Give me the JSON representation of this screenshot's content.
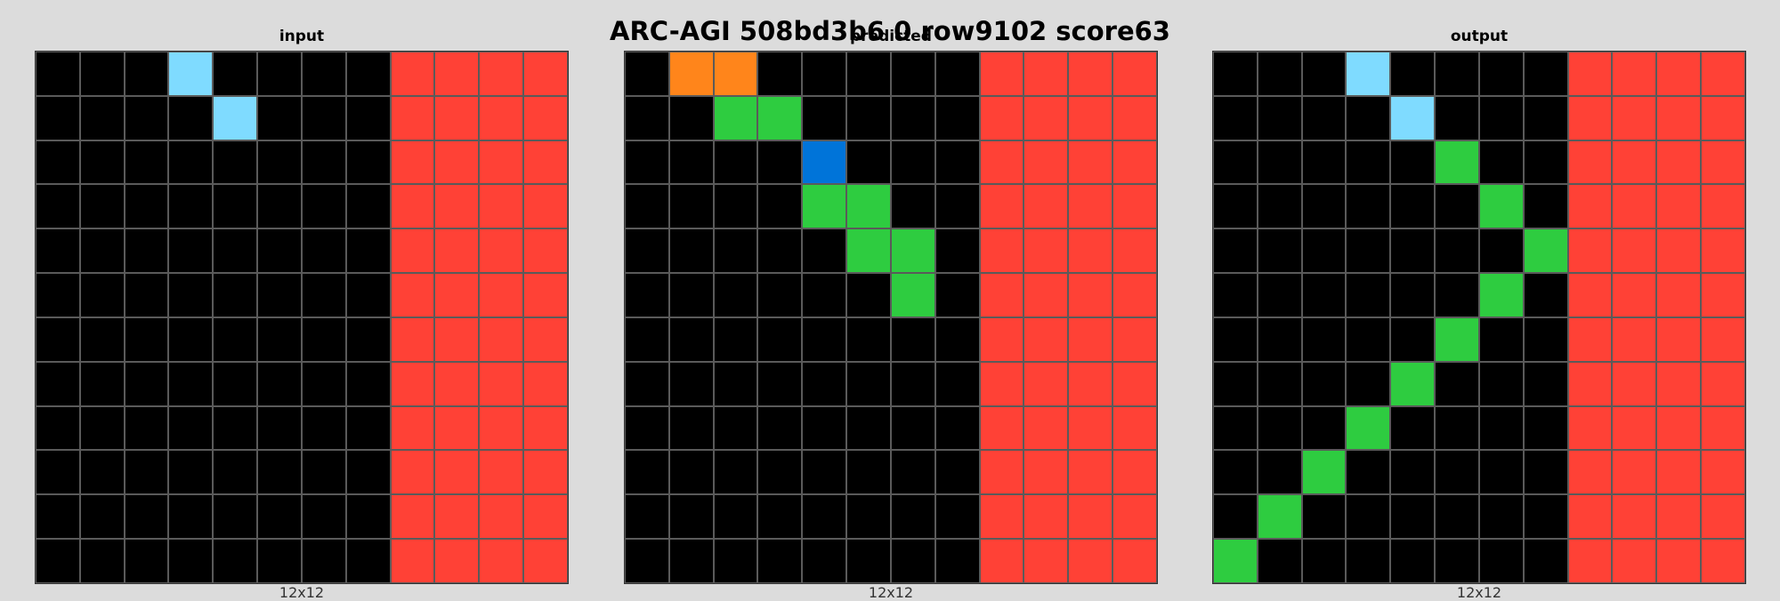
{
  "title": "ARC-AGI 508bd3b6 0 row9102 score63",
  "colors": {
    "0": "#000000",
    "1": "#0074d9",
    "2": "#ff4136",
    "3": "#2ecc40",
    "7": "#ff851b",
    "8": "#7fdbff"
  },
  "panels": [
    {
      "label": "input",
      "dims": "12x12",
      "grid": [
        [
          0,
          0,
          0,
          8,
          0,
          0,
          0,
          0,
          2,
          2,
          2,
          2
        ],
        [
          0,
          0,
          0,
          0,
          8,
          0,
          0,
          0,
          2,
          2,
          2,
          2
        ],
        [
          0,
          0,
          0,
          0,
          0,
          0,
          0,
          0,
          2,
          2,
          2,
          2
        ],
        [
          0,
          0,
          0,
          0,
          0,
          0,
          0,
          0,
          2,
          2,
          2,
          2
        ],
        [
          0,
          0,
          0,
          0,
          0,
          0,
          0,
          0,
          2,
          2,
          2,
          2
        ],
        [
          0,
          0,
          0,
          0,
          0,
          0,
          0,
          0,
          2,
          2,
          2,
          2
        ],
        [
          0,
          0,
          0,
          0,
          0,
          0,
          0,
          0,
          2,
          2,
          2,
          2
        ],
        [
          0,
          0,
          0,
          0,
          0,
          0,
          0,
          0,
          2,
          2,
          2,
          2
        ],
        [
          0,
          0,
          0,
          0,
          0,
          0,
          0,
          0,
          2,
          2,
          2,
          2
        ],
        [
          0,
          0,
          0,
          0,
          0,
          0,
          0,
          0,
          2,
          2,
          2,
          2
        ],
        [
          0,
          0,
          0,
          0,
          0,
          0,
          0,
          0,
          2,
          2,
          2,
          2
        ],
        [
          0,
          0,
          0,
          0,
          0,
          0,
          0,
          0,
          2,
          2,
          2,
          2
        ]
      ]
    },
    {
      "label": "predicted",
      "dims": "12x12",
      "grid": [
        [
          0,
          7,
          7,
          0,
          0,
          0,
          0,
          0,
          2,
          2,
          2,
          2
        ],
        [
          0,
          0,
          3,
          3,
          0,
          0,
          0,
          0,
          2,
          2,
          2,
          2
        ],
        [
          0,
          0,
          0,
          0,
          1,
          0,
          0,
          0,
          2,
          2,
          2,
          2
        ],
        [
          0,
          0,
          0,
          0,
          3,
          3,
          0,
          0,
          2,
          2,
          2,
          2
        ],
        [
          0,
          0,
          0,
          0,
          0,
          3,
          3,
          0,
          2,
          2,
          2,
          2
        ],
        [
          0,
          0,
          0,
          0,
          0,
          0,
          3,
          0,
          2,
          2,
          2,
          2
        ],
        [
          0,
          0,
          0,
          0,
          0,
          0,
          0,
          0,
          2,
          2,
          2,
          2
        ],
        [
          0,
          0,
          0,
          0,
          0,
          0,
          0,
          0,
          2,
          2,
          2,
          2
        ],
        [
          0,
          0,
          0,
          0,
          0,
          0,
          0,
          0,
          2,
          2,
          2,
          2
        ],
        [
          0,
          0,
          0,
          0,
          0,
          0,
          0,
          0,
          2,
          2,
          2,
          2
        ],
        [
          0,
          0,
          0,
          0,
          0,
          0,
          0,
          0,
          2,
          2,
          2,
          2
        ],
        [
          0,
          0,
          0,
          0,
          0,
          0,
          0,
          0,
          2,
          2,
          2,
          2
        ]
      ]
    },
    {
      "label": "output",
      "dims": "12x12",
      "grid": [
        [
          0,
          0,
          0,
          8,
          0,
          0,
          0,
          0,
          2,
          2,
          2,
          2
        ],
        [
          0,
          0,
          0,
          0,
          8,
          0,
          0,
          0,
          2,
          2,
          2,
          2
        ],
        [
          0,
          0,
          0,
          0,
          0,
          3,
          0,
          0,
          2,
          2,
          2,
          2
        ],
        [
          0,
          0,
          0,
          0,
          0,
          0,
          3,
          0,
          2,
          2,
          2,
          2
        ],
        [
          0,
          0,
          0,
          0,
          0,
          0,
          0,
          3,
          2,
          2,
          2,
          2
        ],
        [
          0,
          0,
          0,
          0,
          0,
          0,
          3,
          0,
          2,
          2,
          2,
          2
        ],
        [
          0,
          0,
          0,
          0,
          0,
          3,
          0,
          0,
          2,
          2,
          2,
          2
        ],
        [
          0,
          0,
          0,
          0,
          3,
          0,
          0,
          0,
          2,
          2,
          2,
          2
        ],
        [
          0,
          0,
          0,
          3,
          0,
          0,
          0,
          0,
          2,
          2,
          2,
          2
        ],
        [
          0,
          0,
          3,
          0,
          0,
          0,
          0,
          0,
          2,
          2,
          2,
          2
        ],
        [
          0,
          3,
          0,
          0,
          0,
          0,
          0,
          0,
          2,
          2,
          2,
          2
        ],
        [
          3,
          0,
          0,
          0,
          0,
          0,
          0,
          0,
          2,
          2,
          2,
          2
        ]
      ]
    }
  ]
}
